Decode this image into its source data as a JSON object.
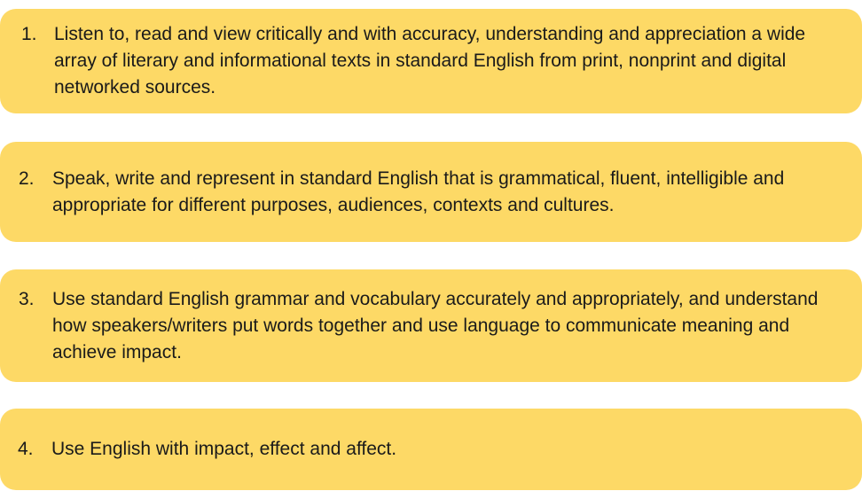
{
  "outcomes": [
    {
      "number": "1.",
      "text": "Listen to, read and view critically and with accuracy, understanding and appreciation a wide array of literary and informational texts in standard English from print, nonprint and digital networked sources."
    },
    {
      "number": "2.",
      "text": "Speak, write and represent in standard English that is grammatical, fluent, intelligible and appropriate for different purposes, audiences, contexts and cultures."
    },
    {
      "number": "3.",
      "text": "Use standard English grammar and vocabulary accurately and appropriately, and understand how speakers/writers put words together and use language to communicate meaning and achieve impact."
    },
    {
      "number": "4.",
      "text": "Use English with impact, effect and affect."
    }
  ],
  "colors": {
    "card_background": "#fdd966",
    "text": "#1a1a1a"
  }
}
